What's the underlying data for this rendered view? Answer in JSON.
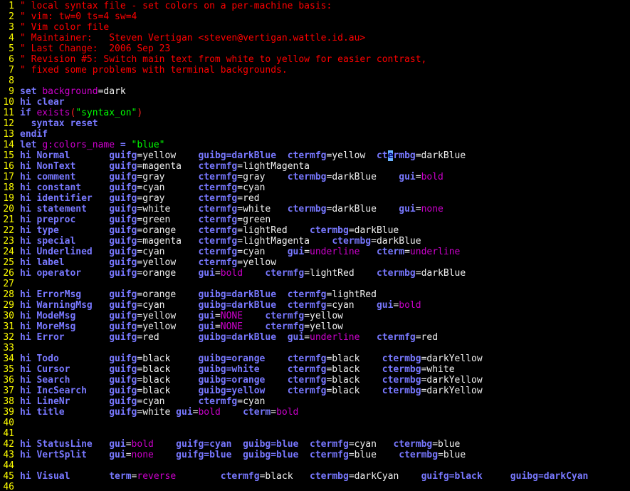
{
  "colors": {
    "background": "#000000",
    "line_number": "#ffff00",
    "comment": "#ff0000",
    "keyword": "#7878ff",
    "statement_text": "#f0f0f0",
    "string": "#00ff00",
    "type_text": "#cc00cc",
    "paren": "#ff2222"
  },
  "lines": [
    {
      "n": "1",
      "t": [
        [
          "c",
          "\" local syntax file - set colors on a per-machine basis:"
        ]
      ]
    },
    {
      "n": "2",
      "t": [
        [
          "c",
          "\" vim: tw=0 ts=4 sw=4"
        ]
      ]
    },
    {
      "n": "3",
      "t": [
        [
          "c",
          "\" Vim color file"
        ]
      ]
    },
    {
      "n": "4",
      "t": [
        [
          "c",
          "\" Maintainer:   Steven Vertigan <steven@vertigan.wattle.id.au>"
        ]
      ]
    },
    {
      "n": "5",
      "t": [
        [
          "c",
          "\" Last Change:  2006 Sep 23"
        ]
      ]
    },
    {
      "n": "6",
      "t": [
        [
          "c",
          "\" Revision #5: Switch main text from white to yellow for easier contrast,"
        ]
      ]
    },
    {
      "n": "7",
      "t": [
        [
          "c",
          "\" fixed some problems with terminal backgrounds."
        ]
      ]
    },
    {
      "n": "8",
      "t": []
    },
    {
      "n": "9",
      "t": [
        [
          "k",
          "set "
        ],
        [
          "v",
          "background"
        ],
        [
          "w",
          "=dark"
        ]
      ]
    },
    {
      "n": "10",
      "t": [
        [
          "k",
          "hi clear"
        ]
      ]
    },
    {
      "n": "11",
      "t": [
        [
          "k",
          "if "
        ],
        [
          "v",
          "exists"
        ],
        [
          "p",
          "("
        ],
        [
          "s",
          "\"syntax_on\""
        ],
        [
          "p",
          ")"
        ]
      ]
    },
    {
      "n": "12",
      "t": [
        [
          "k",
          "  syntax reset"
        ]
      ]
    },
    {
      "n": "13",
      "t": [
        [
          "k",
          "endif"
        ]
      ]
    },
    {
      "n": "14",
      "t": [
        [
          "k",
          "let "
        ],
        [
          "v",
          "g:colors_name "
        ],
        [
          "k",
          "= "
        ],
        [
          "s",
          "\"blue\""
        ]
      ]
    },
    {
      "n": "15",
      "t": [
        [
          "k",
          "hi Normal       guifg"
        ],
        [
          "w",
          "=yellow    "
        ],
        [
          "k",
          "guibg=darkBlue  ctermfg"
        ],
        [
          "w",
          "=yellow  "
        ],
        [
          "k",
          "ct"
        ],
        [
          "cur",
          "e"
        ],
        [
          "k",
          "rmbg"
        ],
        [
          "w",
          "=darkBlue"
        ]
      ]
    },
    {
      "n": "16",
      "t": [
        [
          "k",
          "hi NonText      guifg"
        ],
        [
          "w",
          "=magenta   "
        ],
        [
          "k",
          "ctermfg"
        ],
        [
          "w",
          "=lightMagenta"
        ]
      ]
    },
    {
      "n": "17",
      "t": [
        [
          "k",
          "hi comment      guifg"
        ],
        [
          "w",
          "=gray      "
        ],
        [
          "k",
          "ctermfg"
        ],
        [
          "w",
          "=gray    "
        ],
        [
          "k",
          "ctermbg"
        ],
        [
          "w",
          "=darkBlue    "
        ],
        [
          "k",
          "gui"
        ],
        [
          "w",
          "="
        ],
        [
          "m",
          "bold"
        ]
      ]
    },
    {
      "n": "18",
      "t": [
        [
          "k",
          "hi constant     guifg"
        ],
        [
          "w",
          "=cyan      "
        ],
        [
          "k",
          "ctermfg"
        ],
        [
          "w",
          "=cyan"
        ]
      ]
    },
    {
      "n": "19",
      "t": [
        [
          "k",
          "hi identifier   guifg"
        ],
        [
          "w",
          "=gray      "
        ],
        [
          "k",
          "ctermfg"
        ],
        [
          "w",
          "=red"
        ]
      ]
    },
    {
      "n": "20",
      "t": [
        [
          "k",
          "hi statement    guifg"
        ],
        [
          "w",
          "=white     "
        ],
        [
          "k",
          "ctermfg"
        ],
        [
          "w",
          "=white   "
        ],
        [
          "k",
          "ctermbg"
        ],
        [
          "w",
          "=darkBlue    "
        ],
        [
          "k",
          "gui"
        ],
        [
          "w",
          "="
        ],
        [
          "m",
          "none"
        ]
      ]
    },
    {
      "n": "21",
      "t": [
        [
          "k",
          "hi preproc      guifg"
        ],
        [
          "w",
          "=green     "
        ],
        [
          "k",
          "ctermfg"
        ],
        [
          "w",
          "=green"
        ]
      ]
    },
    {
      "n": "22",
      "t": [
        [
          "k",
          "hi type         guifg"
        ],
        [
          "w",
          "=orange    "
        ],
        [
          "k",
          "ctermfg"
        ],
        [
          "w",
          "=lightRed    "
        ],
        [
          "k",
          "ctermbg"
        ],
        [
          "w",
          "=darkBlue"
        ]
      ]
    },
    {
      "n": "23",
      "t": [
        [
          "k",
          "hi special      guifg"
        ],
        [
          "w",
          "=magenta   "
        ],
        [
          "k",
          "ctermfg"
        ],
        [
          "w",
          "=lightMagenta    "
        ],
        [
          "k",
          "ctermbg"
        ],
        [
          "w",
          "=darkBlue"
        ]
      ]
    },
    {
      "n": "24",
      "t": [
        [
          "k",
          "hi Underlined   guifg"
        ],
        [
          "w",
          "=cyan      "
        ],
        [
          "k",
          "ctermfg"
        ],
        [
          "w",
          "=cyan    "
        ],
        [
          "k",
          "gui"
        ],
        [
          "w",
          "="
        ],
        [
          "m",
          "underline   "
        ],
        [
          "k",
          "cterm"
        ],
        [
          "w",
          "="
        ],
        [
          "m",
          "underline"
        ]
      ]
    },
    {
      "n": "25",
      "t": [
        [
          "k",
          "hi label        guifg"
        ],
        [
          "w",
          "=yellow    "
        ],
        [
          "k",
          "ctermfg"
        ],
        [
          "w",
          "=yellow"
        ]
      ]
    },
    {
      "n": "26",
      "t": [
        [
          "k",
          "hi operator     guifg"
        ],
        [
          "w",
          "=orange    "
        ],
        [
          "k",
          "gui"
        ],
        [
          "w",
          "="
        ],
        [
          "m",
          "bold    "
        ],
        [
          "k",
          "ctermfg"
        ],
        [
          "w",
          "=lightRed    "
        ],
        [
          "k",
          "ctermbg"
        ],
        [
          "w",
          "=darkBlue"
        ]
      ]
    },
    {
      "n": "27",
      "t": []
    },
    {
      "n": "28",
      "t": [
        [
          "k",
          "hi ErrorMsg     guifg"
        ],
        [
          "w",
          "=orange    "
        ],
        [
          "k",
          "guibg=darkBlue  ctermfg"
        ],
        [
          "w",
          "=lightRed"
        ]
      ]
    },
    {
      "n": "29",
      "t": [
        [
          "k",
          "hi WarningMsg   guifg"
        ],
        [
          "w",
          "=cyan      "
        ],
        [
          "k",
          "guibg=darkBlue  ctermfg"
        ],
        [
          "w",
          "=cyan    "
        ],
        [
          "k",
          "gui"
        ],
        [
          "w",
          "="
        ],
        [
          "m",
          "bold"
        ]
      ]
    },
    {
      "n": "30",
      "t": [
        [
          "k",
          "hi ModeMsg      guifg"
        ],
        [
          "w",
          "=yellow    "
        ],
        [
          "k",
          "gui"
        ],
        [
          "w",
          "="
        ],
        [
          "m",
          "NONE    "
        ],
        [
          "k",
          "ctermfg"
        ],
        [
          "w",
          "=yellow"
        ]
      ]
    },
    {
      "n": "31",
      "t": [
        [
          "k",
          "hi MoreMsg      guifg"
        ],
        [
          "w",
          "=yellow    "
        ],
        [
          "k",
          "gui"
        ],
        [
          "w",
          "="
        ],
        [
          "m",
          "NONE    "
        ],
        [
          "k",
          "ctermfg"
        ],
        [
          "w",
          "=yellow"
        ]
      ]
    },
    {
      "n": "32",
      "t": [
        [
          "k",
          "hi Error        guifg"
        ],
        [
          "w",
          "=red       "
        ],
        [
          "k",
          "guibg=darkBlue  gui"
        ],
        [
          "w",
          "="
        ],
        [
          "m",
          "underline   "
        ],
        [
          "k",
          "ctermfg"
        ],
        [
          "w",
          "=red"
        ]
      ]
    },
    {
      "n": "33",
      "t": []
    },
    {
      "n": "34",
      "t": [
        [
          "k",
          "hi Todo         guifg"
        ],
        [
          "w",
          "=black     "
        ],
        [
          "k",
          "guibg=orange    ctermfg"
        ],
        [
          "w",
          "=black    "
        ],
        [
          "k",
          "ctermbg"
        ],
        [
          "w",
          "=darkYellow"
        ]
      ]
    },
    {
      "n": "35",
      "t": [
        [
          "k",
          "hi Cursor       guifg"
        ],
        [
          "w",
          "=black     "
        ],
        [
          "k",
          "guibg=white     ctermfg"
        ],
        [
          "w",
          "=black    "
        ],
        [
          "k",
          "ctermbg"
        ],
        [
          "w",
          "=white"
        ]
      ]
    },
    {
      "n": "36",
      "t": [
        [
          "k",
          "hi Search       guifg"
        ],
        [
          "w",
          "=black     "
        ],
        [
          "k",
          "guibg=orange    ctermfg"
        ],
        [
          "w",
          "=black    "
        ],
        [
          "k",
          "ctermbg"
        ],
        [
          "w",
          "=darkYellow"
        ]
      ]
    },
    {
      "n": "37",
      "t": [
        [
          "k",
          "hi IncSearch    guifg"
        ],
        [
          "w",
          "=black     "
        ],
        [
          "k",
          "guibg=yellow    ctermfg"
        ],
        [
          "w",
          "=black    "
        ],
        [
          "k",
          "ctermbg"
        ],
        [
          "w",
          "=darkYellow"
        ]
      ]
    },
    {
      "n": "38",
      "t": [
        [
          "k",
          "hi LineNr       guifg"
        ],
        [
          "w",
          "=cyan      "
        ],
        [
          "k",
          "ctermfg"
        ],
        [
          "w",
          "=cyan"
        ]
      ]
    },
    {
      "n": "39",
      "t": [
        [
          "k",
          "hi title        guifg"
        ],
        [
          "w",
          "=white "
        ],
        [
          "k",
          "gui"
        ],
        [
          "w",
          "="
        ],
        [
          "m",
          "bold    "
        ],
        [
          "k",
          "cterm"
        ],
        [
          "w",
          "="
        ],
        [
          "m",
          "bold"
        ]
      ]
    },
    {
      "n": "40",
      "t": []
    },
    {
      "n": "41",
      "t": []
    },
    {
      "n": "42",
      "t": [
        [
          "k",
          "hi StatusLine   gui"
        ],
        [
          "w",
          "="
        ],
        [
          "m",
          "bold    "
        ],
        [
          "k",
          "guifg=cyan  guibg=blue  ctermfg"
        ],
        [
          "w",
          "=cyan   "
        ],
        [
          "k",
          "ctermbg"
        ],
        [
          "w",
          "=blue"
        ]
      ]
    },
    {
      "n": "43",
      "t": [
        [
          "k",
          "hi VertSplit    gui"
        ],
        [
          "w",
          "="
        ],
        [
          "m",
          "none    "
        ],
        [
          "k",
          "guifg=blue  guibg=blue  ctermfg"
        ],
        [
          "w",
          "=blue    "
        ],
        [
          "k",
          "ctermbg"
        ],
        [
          "w",
          "=blue"
        ]
      ]
    },
    {
      "n": "44",
      "t": []
    },
    {
      "n": "45",
      "t": [
        [
          "k",
          "hi Visual       term"
        ],
        [
          "w",
          "="
        ],
        [
          "m",
          "reverse        "
        ],
        [
          "k",
          "ctermfg"
        ],
        [
          "w",
          "=black   "
        ],
        [
          "k",
          "ctermbg"
        ],
        [
          "w",
          "=darkCyan    "
        ],
        [
          "k",
          "guifg=black     guibg=darkCyan"
        ]
      ]
    },
    {
      "n": "46",
      "t": []
    }
  ]
}
